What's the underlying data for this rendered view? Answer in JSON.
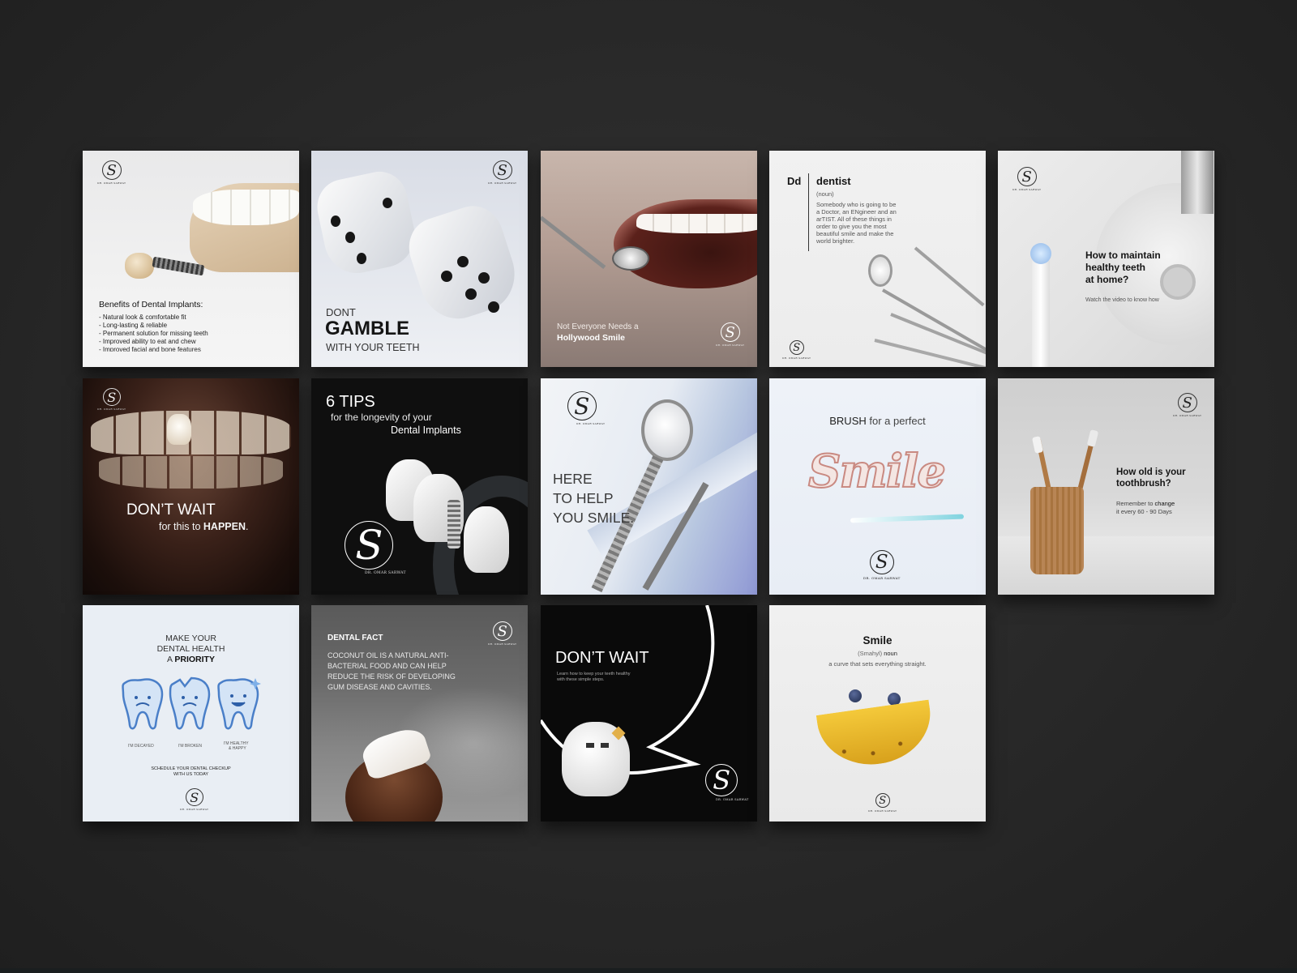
{
  "brand": {
    "logo_letter": "S",
    "logo_caption": "DR. OMAR SARWAT"
  },
  "cards": {
    "c1": {
      "heading": "Benefits of Dental Implants:",
      "items": [
        "- Natural look & comfortable fit",
        "- Long-lasting & reliable",
        "- Permanent solution for missing teeth",
        "- Improved ability to eat and chew",
        "- Improved facial and bone features"
      ]
    },
    "c2": {
      "line1": "DONT",
      "line2": "GAMBLE",
      "line3": "WITH YOUR TEETH"
    },
    "c3": {
      "line1": "Not Everyone Needs a",
      "line2": "Hollywood Smile"
    },
    "c4": {
      "abbr": "Dd",
      "word": "dentist",
      "pos": "(noun)",
      "definition": [
        "Somebody who is going to be",
        "a Doctor, an ENgineer and an",
        "arTIST. All of these things in",
        "order to give you the most",
        "beautiful smile and make the",
        "world brighter."
      ]
    },
    "c5": {
      "line1": "How to maintain",
      "line2": "healthy teeth",
      "line3": "at home?",
      "sub": "Watch the video to know how"
    },
    "c6": {
      "line1": "DON’T WAIT",
      "line2_prefix": "for this to ",
      "line2_strong": "HAPPEN",
      "line2_end": "."
    },
    "c7": {
      "line1": "6 TIPS",
      "line2": "for the longevity of your",
      "line3": "Dental Implants"
    },
    "c8": {
      "line1": "HERE",
      "line2": "TO HELP",
      "line3": "YOU SMILE."
    },
    "c9": {
      "strong": "BRUSH",
      "rest": " for a perfect",
      "script": "Smile"
    },
    "c10": {
      "line1": "How old is your",
      "line2": "toothbrush?",
      "sub1_prefix": "Remember to ",
      "sub1_strong": "change",
      "sub2": "it every 60 - 90 Days"
    },
    "c11": {
      "line1": "MAKE YOUR",
      "line2": "DENTAL HEALTH",
      "line3_prefix": "A ",
      "line3_strong": "PRIORITY",
      "label1": "I'M DECAYED",
      "label2": "I'M BROKEN",
      "label3a": "I'M HEALTHY",
      "label3b": "& HAPPY",
      "cta1": "SCHEDULE YOUR DENTAL CHECKUP",
      "cta2": "WITH US TODAY"
    },
    "c12": {
      "title": "DENTAL FACT",
      "body": [
        "COCONUT OIL IS A NATURAL ANTI-",
        "BACTERIAL FOOD AND CAN HELP",
        "REDUCE THE RISK OF DEVELOPING",
        "GUM DISEASE AND CAVITIES."
      ]
    },
    "c13": {
      "title": "DON’T WAIT",
      "sub1": "Learn how to keep your teeth healthy",
      "sub2": "with these simple steps."
    },
    "c14": {
      "word": "Smile",
      "pron_prefix": "(Smahyl) ",
      "pron_strong": "noun",
      "definition": "a curve that sets everything straight."
    }
  },
  "colors": {
    "background": "#2a2a2a",
    "accent_blue": "#5a8fd6",
    "dark_card": "#0d0d0d"
  }
}
